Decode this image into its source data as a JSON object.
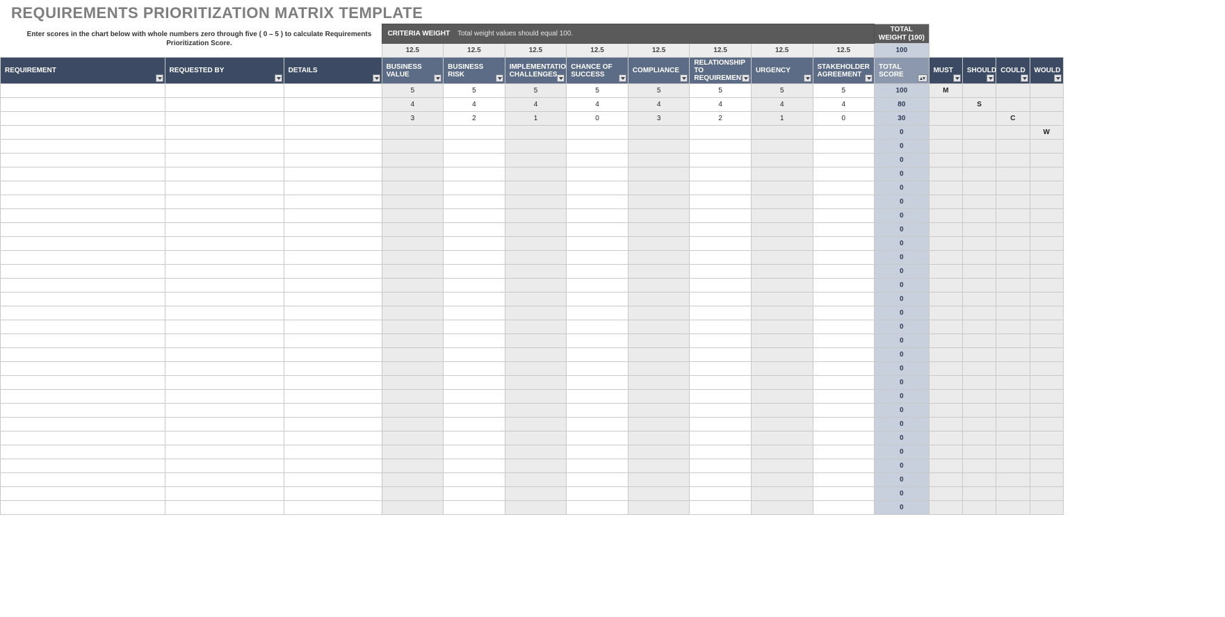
{
  "title": "REQUIREMENTS PRIORITIZATION MATRIX TEMPLATE",
  "instructions": "Enter scores in the chart below with whole numbers zero through five ( 0 – 5 ) to calculate Requirements Prioritization Score.",
  "criteria_bar": {
    "label": "CRITERIA WEIGHT",
    "sub": "Total weight values should equal 100."
  },
  "total_weight_label": "TOTAL WEIGHT (100)",
  "headers": {
    "requirement": "REQUIREMENT",
    "requested_by": "REQUESTED BY",
    "details": "DETAILS",
    "total_score": "TOTAL SCORE",
    "must": "MUST",
    "should": "SHOULD",
    "could": "COULD",
    "would": "WOULD"
  },
  "criteria": [
    "BUSINESS VALUE",
    "BUSINESS RISK",
    "IMPLEMENTATION CHALLENGES",
    "CHANCE OF SUCCESS",
    "COMPLIANCE",
    "RELATIONSHIP TO REQUIREMENTS",
    "URGENCY",
    "STAKEHOLDER AGREEMENT"
  ],
  "weights": [
    "12.5",
    "12.5",
    "12.5",
    "12.5",
    "12.5",
    "12.5",
    "12.5",
    "12.5"
  ],
  "weights_total": "100",
  "rows": [
    {
      "scores": [
        "5",
        "5",
        "5",
        "5",
        "5",
        "5",
        "5",
        "5"
      ],
      "total": "100",
      "must": "M",
      "should": "",
      "could": "",
      "would": ""
    },
    {
      "scores": [
        "4",
        "4",
        "4",
        "4",
        "4",
        "4",
        "4",
        "4"
      ],
      "total": "80",
      "must": "",
      "should": "S",
      "could": "",
      "would": ""
    },
    {
      "scores": [
        "3",
        "2",
        "1",
        "0",
        "3",
        "2",
        "1",
        "0"
      ],
      "total": "30",
      "must": "",
      "should": "",
      "could": "C",
      "would": ""
    },
    {
      "scores": [
        "",
        "",
        "",
        "",
        "",
        "",
        "",
        ""
      ],
      "total": "0",
      "must": "",
      "should": "",
      "could": "",
      "would": "W"
    },
    {
      "scores": [
        "",
        "",
        "",
        "",
        "",
        "",
        "",
        ""
      ],
      "total": "0",
      "must": "",
      "should": "",
      "could": "",
      "would": ""
    },
    {
      "scores": [
        "",
        "",
        "",
        "",
        "",
        "",
        "",
        ""
      ],
      "total": "0",
      "must": "",
      "should": "",
      "could": "",
      "would": ""
    },
    {
      "scores": [
        "",
        "",
        "",
        "",
        "",
        "",
        "",
        ""
      ],
      "total": "0",
      "must": "",
      "should": "",
      "could": "",
      "would": ""
    },
    {
      "scores": [
        "",
        "",
        "",
        "",
        "",
        "",
        "",
        ""
      ],
      "total": "0",
      "must": "",
      "should": "",
      "could": "",
      "would": ""
    },
    {
      "scores": [
        "",
        "",
        "",
        "",
        "",
        "",
        "",
        ""
      ],
      "total": "0",
      "must": "",
      "should": "",
      "could": "",
      "would": ""
    },
    {
      "scores": [
        "",
        "",
        "",
        "",
        "",
        "",
        "",
        ""
      ],
      "total": "0",
      "must": "",
      "should": "",
      "could": "",
      "would": ""
    },
    {
      "scores": [
        "",
        "",
        "",
        "",
        "",
        "",
        "",
        ""
      ],
      "total": "0",
      "must": "",
      "should": "",
      "could": "",
      "would": ""
    },
    {
      "scores": [
        "",
        "",
        "",
        "",
        "",
        "",
        "",
        ""
      ],
      "total": "0",
      "must": "",
      "should": "",
      "could": "",
      "would": ""
    },
    {
      "scores": [
        "",
        "",
        "",
        "",
        "",
        "",
        "",
        ""
      ],
      "total": "0",
      "must": "",
      "should": "",
      "could": "",
      "would": ""
    },
    {
      "scores": [
        "",
        "",
        "",
        "",
        "",
        "",
        "",
        ""
      ],
      "total": "0",
      "must": "",
      "should": "",
      "could": "",
      "would": ""
    },
    {
      "scores": [
        "",
        "",
        "",
        "",
        "",
        "",
        "",
        ""
      ],
      "total": "0",
      "must": "",
      "should": "",
      "could": "",
      "would": ""
    },
    {
      "scores": [
        "",
        "",
        "",
        "",
        "",
        "",
        "",
        ""
      ],
      "total": "0",
      "must": "",
      "should": "",
      "could": "",
      "would": ""
    },
    {
      "scores": [
        "",
        "",
        "",
        "",
        "",
        "",
        "",
        ""
      ],
      "total": "0",
      "must": "",
      "should": "",
      "could": "",
      "would": ""
    },
    {
      "scores": [
        "",
        "",
        "",
        "",
        "",
        "",
        "",
        ""
      ],
      "total": "0",
      "must": "",
      "should": "",
      "could": "",
      "would": ""
    },
    {
      "scores": [
        "",
        "",
        "",
        "",
        "",
        "",
        "",
        ""
      ],
      "total": "0",
      "must": "",
      "should": "",
      "could": "",
      "would": ""
    },
    {
      "scores": [
        "",
        "",
        "",
        "",
        "",
        "",
        "",
        ""
      ],
      "total": "0",
      "must": "",
      "should": "",
      "could": "",
      "would": ""
    },
    {
      "scores": [
        "",
        "",
        "",
        "",
        "",
        "",
        "",
        ""
      ],
      "total": "0",
      "must": "",
      "should": "",
      "could": "",
      "would": ""
    },
    {
      "scores": [
        "",
        "",
        "",
        "",
        "",
        "",
        "",
        ""
      ],
      "total": "0",
      "must": "",
      "should": "",
      "could": "",
      "would": ""
    },
    {
      "scores": [
        "",
        "",
        "",
        "",
        "",
        "",
        "",
        ""
      ],
      "total": "0",
      "must": "",
      "should": "",
      "could": "",
      "would": ""
    },
    {
      "scores": [
        "",
        "",
        "",
        "",
        "",
        "",
        "",
        ""
      ],
      "total": "0",
      "must": "",
      "should": "",
      "could": "",
      "would": ""
    },
    {
      "scores": [
        "",
        "",
        "",
        "",
        "",
        "",
        "",
        ""
      ],
      "total": "0",
      "must": "",
      "should": "",
      "could": "",
      "would": ""
    },
    {
      "scores": [
        "",
        "",
        "",
        "",
        "",
        "",
        "",
        ""
      ],
      "total": "0",
      "must": "",
      "should": "",
      "could": "",
      "would": ""
    },
    {
      "scores": [
        "",
        "",
        "",
        "",
        "",
        "",
        "",
        ""
      ],
      "total": "0",
      "must": "",
      "should": "",
      "could": "",
      "would": ""
    },
    {
      "scores": [
        "",
        "",
        "",
        "",
        "",
        "",
        "",
        ""
      ],
      "total": "0",
      "must": "",
      "should": "",
      "could": "",
      "would": ""
    },
    {
      "scores": [
        "",
        "",
        "",
        "",
        "",
        "",
        "",
        ""
      ],
      "total": "0",
      "must": "",
      "should": "",
      "could": "",
      "would": ""
    },
    {
      "scores": [
        "",
        "",
        "",
        "",
        "",
        "",
        "",
        ""
      ],
      "total": "0",
      "must": "",
      "should": "",
      "could": "",
      "would": ""
    },
    {
      "scores": [
        "",
        "",
        "",
        "",
        "",
        "",
        "",
        ""
      ],
      "total": "0",
      "must": "",
      "should": "",
      "could": "",
      "would": ""
    }
  ]
}
